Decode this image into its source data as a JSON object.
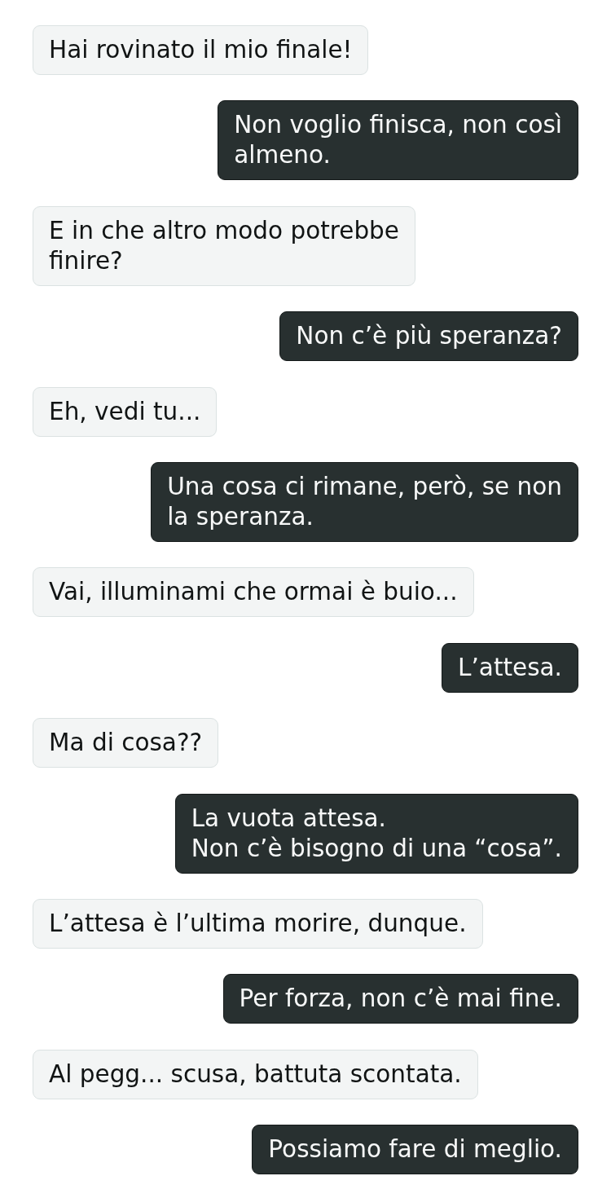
{
  "messages": [
    {
      "outgoing": false,
      "text": "Hai rovinato il mio finale!"
    },
    {
      "outgoing": true,
      "text": "Non voglio finisca, non così\nalmeno."
    },
    {
      "outgoing": false,
      "text": "E in che altro modo potrebbe\nfinire?"
    },
    {
      "outgoing": true,
      "text": "Non c’è più speranza?"
    },
    {
      "outgoing": false,
      "text": "Eh, vedi tu..."
    },
    {
      "outgoing": true,
      "text": "Una cosa ci rimane, però, se non\nla speranza."
    },
    {
      "outgoing": false,
      "text": "Vai, illuminami che ormai è buio..."
    },
    {
      "outgoing": true,
      "text": "L’attesa."
    },
    {
      "outgoing": false,
      "text": "Ma di cosa??"
    },
    {
      "outgoing": true,
      "text": "La vuota attesa.\nNon c’è bisogno di una “cosa”."
    },
    {
      "outgoing": false,
      "text": "L’attesa è l’ultima morire, dunque."
    },
    {
      "outgoing": true,
      "text": "Per forza, non c’è mai fine."
    },
    {
      "outgoing": false,
      "text": "Al pegg... scusa, battuta scontata."
    },
    {
      "outgoing": true,
      "text": "Possiamo fare di meglio."
    }
  ]
}
